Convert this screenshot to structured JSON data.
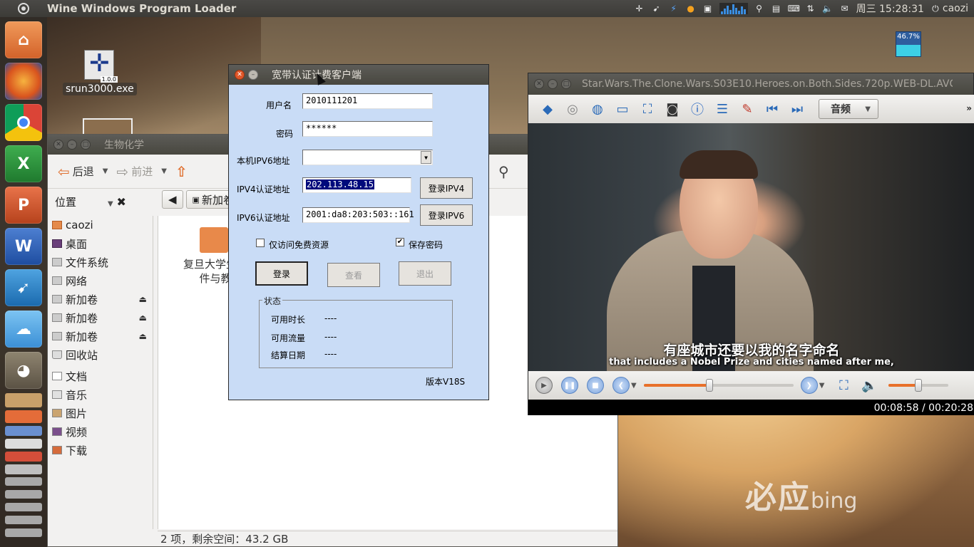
{
  "top_panel": {
    "app_title": "Wine Windows Program Loader",
    "clock": "周三 15:28:31",
    "user": "caozi"
  },
  "desktop": {
    "icon_label": "srun3000.exe",
    "icon_version": "1.0.0",
    "cpu_meter": "46.7%",
    "cpu_meter_level": 0.467,
    "wallpaper_text": "必应",
    "wallpaper_brand": "bing"
  },
  "launcher": {
    "apps": [
      "home-folder",
      "firefox",
      "chrome",
      "excel",
      "powerpoint",
      "word",
      "feeds",
      "weather",
      "gimp"
    ]
  },
  "nautilus": {
    "title": "生物化学",
    "back": "后退",
    "forward": "前进",
    "sidebar_header": "位置",
    "path_segment": "新加卷",
    "sidebar_items": [
      {
        "label": "caozi",
        "icon": "home-icon"
      },
      {
        "label": "桌面",
        "icon": "desktop-icon"
      },
      {
        "label": "文件系统",
        "icon": "drive-icon"
      },
      {
        "label": "网络",
        "icon": "network-icon"
      },
      {
        "label": "新加卷",
        "icon": "drive-icon"
      },
      {
        "label": "新加卷",
        "icon": "drive-icon"
      },
      {
        "label": "新加卷",
        "icon": "drive-icon"
      },
      {
        "label": "回收站",
        "icon": "trash-icon"
      },
      {
        "label": "文档",
        "icon": "documents-icon"
      },
      {
        "label": "音乐",
        "icon": "music-icon"
      },
      {
        "label": "图片",
        "icon": "pictures-icon"
      },
      {
        "label": "视频",
        "icon": "videos-icon"
      },
      {
        "label": "下载",
        "icon": "downloads-icon"
      }
    ],
    "file_label_line1": "复旦大学生物",
    "file_label_line2": "件与教",
    "status": "2 项，剩余空间：43.2 GB"
  },
  "srun": {
    "title": "宽带认证计费客户端",
    "username_label": "用户名",
    "username_value": "2010111201",
    "password_label": "密码",
    "password_value": "******",
    "ipv6_local_label": "本机IPV6地址",
    "ipv6_local_value": "",
    "ipv4_auth_label": "IPV4认证地址",
    "ipv4_auth_value": "202.113.48.15",
    "ipv6_auth_label": "IPV6认证地址",
    "ipv6_auth_value": "2001:da8:203:503::161",
    "login_ipv4": "登录IPV4",
    "login_ipv6": "登录IPV6",
    "free_only_label": "仅访问免费资源",
    "free_only_checked": false,
    "save_pw_label": "保存密码",
    "save_pw_checked": true,
    "login": "登录",
    "view": "查看",
    "exit": "退出",
    "status_group": "状态",
    "avail_time_label": "可用时长",
    "avail_time_value": "----",
    "avail_traffic_label": "可用流量",
    "avail_traffic_value": "----",
    "settle_date_label": "结算日期",
    "settle_date_value": "----",
    "version": "版本V18S"
  },
  "player": {
    "title": "Star.Wars.The.Clone.Wars.S03E10.Heroes.on.Both.Sides.720p.WEB-DL.AVC.AC",
    "audio_btn": "音频",
    "subtitle_cn": "有座城市还要以我的名字命名",
    "subtitle_en": "that includes a Nobel Prize and cities named after me,",
    "time": "00:08:58 / 00:20:28",
    "seek_fraction": 0.438,
    "volume_fraction": 0.5
  }
}
